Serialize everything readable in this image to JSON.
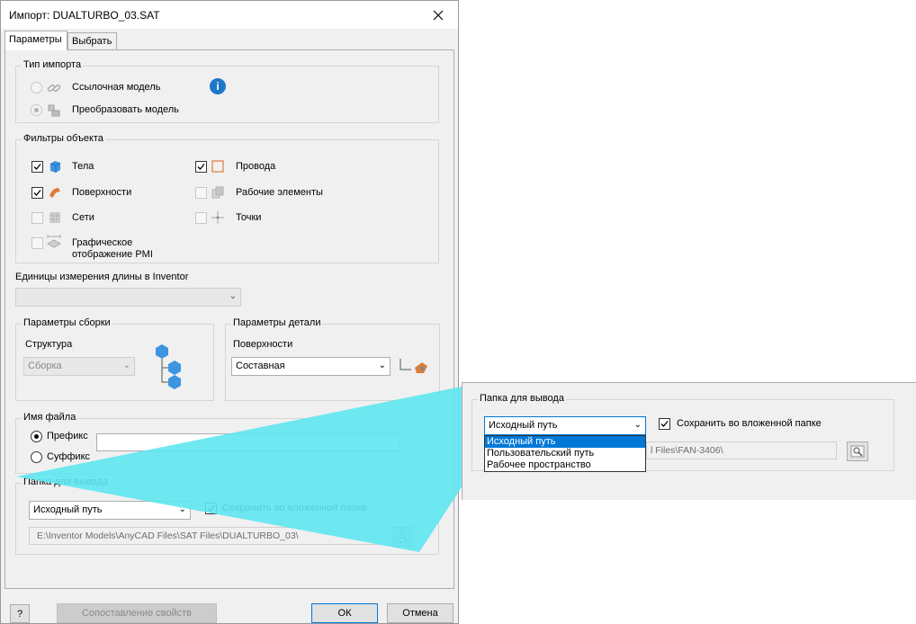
{
  "window": {
    "title": "Импорт: DUALTURBO_03.SAT"
  },
  "tabs": [
    {
      "label": "Параметры"
    },
    {
      "label": "Выбрать"
    }
  ],
  "import_type": {
    "legend": "Тип импорта",
    "options": [
      {
        "label": "Ссылочная модель"
      },
      {
        "label": "Преобразовать модель"
      }
    ]
  },
  "object_filters": {
    "legend": "Фильтры объекта",
    "items": [
      {
        "label": "Тела",
        "checked": true
      },
      {
        "label": "Провода",
        "checked": true
      },
      {
        "label": "Поверхности",
        "checked": true
      },
      {
        "label": "Рабочие элементы",
        "checked": false
      },
      {
        "label": "Сети",
        "checked": false
      },
      {
        "label": "Точки",
        "checked": false
      },
      {
        "label_line1": "Графическое",
        "label_line2": "отображение PMI",
        "checked": false
      }
    ]
  },
  "units": {
    "label": "Единицы измерения длины в Inventor",
    "value": ""
  },
  "assembly": {
    "legend": "Параметры сборки",
    "structure_label": "Структура",
    "structure_value": "Сборка"
  },
  "part": {
    "legend": "Параметры детали",
    "surfaces_label": "Поверхности",
    "surfaces_value": "Составная"
  },
  "filename": {
    "legend": "Имя файла",
    "prefix_label": "Префикс",
    "suffix_label": "Суффикс",
    "value": ""
  },
  "output": {
    "legend": "Папка для вывода",
    "location": "Исходный путь",
    "save_subfolder_label": "Сохранить во вложенной папке",
    "path": "E:\\Inventor Models\\AnyCAD Files\\SAT Files\\DUALTURBO_03\\"
  },
  "footer": {
    "help": "?",
    "map_props": "Сопоставление свойств",
    "ok": "ОК",
    "cancel": "Отмена"
  },
  "zoom": {
    "legend": "Папка для вывода",
    "location": "Исходный путь",
    "save_subfolder_label": "Сохранить во вложенной папке",
    "path_partial": "l Files\\FAN-3406\\",
    "options": [
      "Исходный путь",
      "Пользовательский путь",
      "Рабочее пространство"
    ]
  },
  "colors": {
    "accent": "#0078d7",
    "callout": "#5ee6f0"
  }
}
